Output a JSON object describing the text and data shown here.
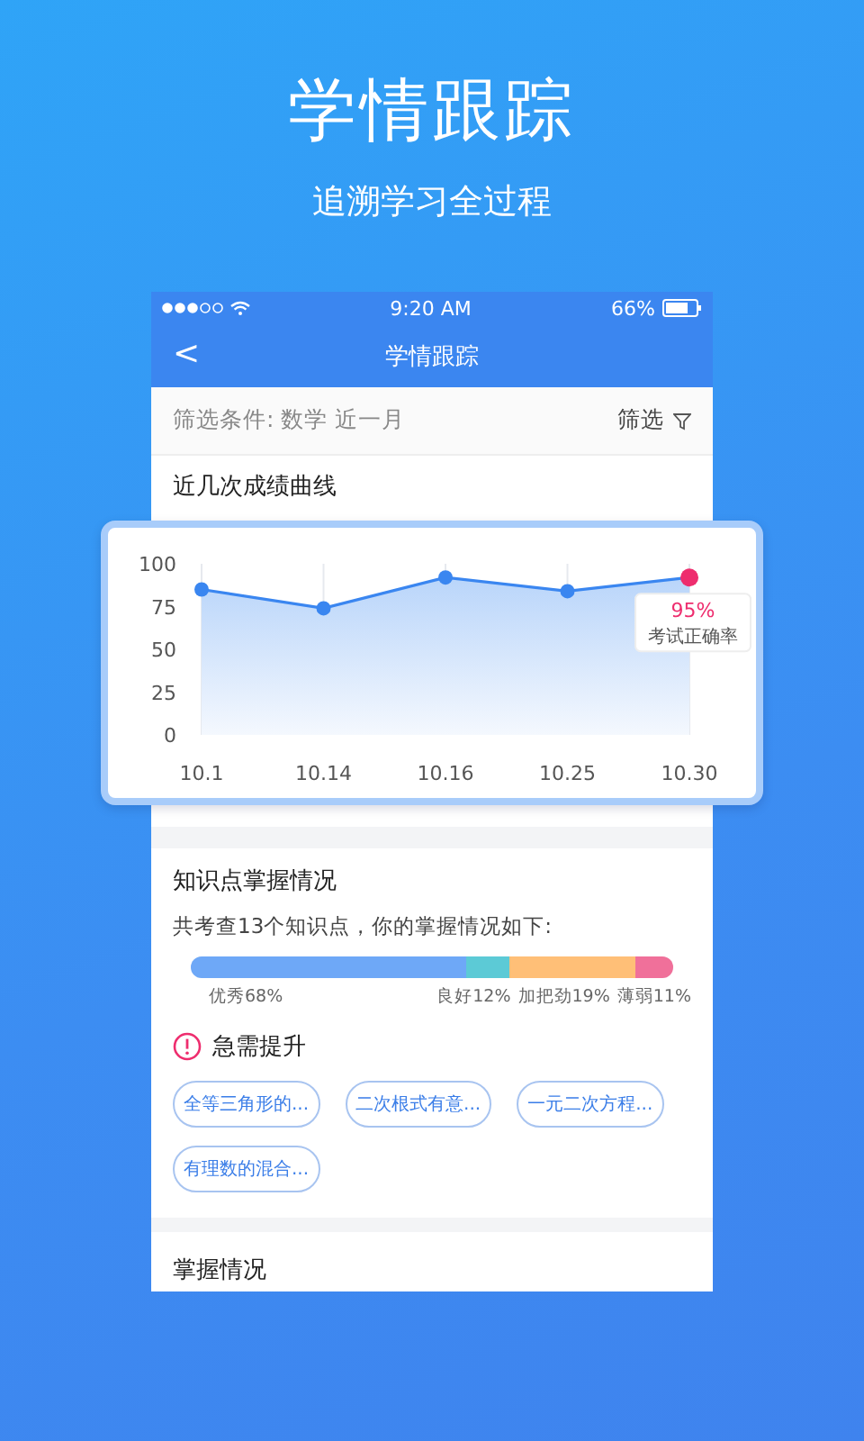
{
  "hero": {
    "title": "学情跟踪",
    "subtitle": "追溯学习全过程"
  },
  "status_bar": {
    "time": "9:20 AM",
    "battery": "66%"
  },
  "nav": {
    "back": "<",
    "title": "学情跟踪"
  },
  "filter": {
    "conditions": "筛选条件: 数学 近一月",
    "button": "筛选"
  },
  "score_section": {
    "title": "近几次成绩曲线",
    "chart_data": {
      "type": "line",
      "categories": [
        "10.1",
        "10.14",
        "10.16",
        "10.25",
        "10.30"
      ],
      "series": [
        {
          "name": "考试正确率",
          "color": "#3a86f0",
          "marker": true,
          "values": [
            85,
            74,
            92,
            84,
            92
          ]
        }
      ],
      "ylim": [
        0,
        100
      ],
      "yticks": [
        0,
        25,
        50,
        75,
        100
      ],
      "grid": true,
      "annotations": [
        {
          "x": "10.30",
          "y": 92,
          "text": "95%"
        }
      ]
    }
  },
  "knowledge": {
    "title": "知识点掌握情况",
    "summary": "共考查13个知识点，你的掌握情况如下:",
    "segments": [
      {
        "label": "优秀68%",
        "level": 0.57,
        "color": "#6ea8f7"
      },
      {
        "label": "良好12%",
        "level": 0.66,
        "color": "#5ccad6"
      },
      {
        "label": "加把劲19%",
        "level": 0.92,
        "color": "#ffbf77"
      },
      {
        "label": "薄弱11%",
        "level": 1,
        "color": "#f0709a"
      }
    ],
    "urgent_title": "急需提升",
    "tags": [
      "全等三角形的...",
      "二次根式有意...",
      "一元二次方程...",
      "有理数的混合..."
    ]
  },
  "mastery": {
    "title": "掌握情况"
  }
}
